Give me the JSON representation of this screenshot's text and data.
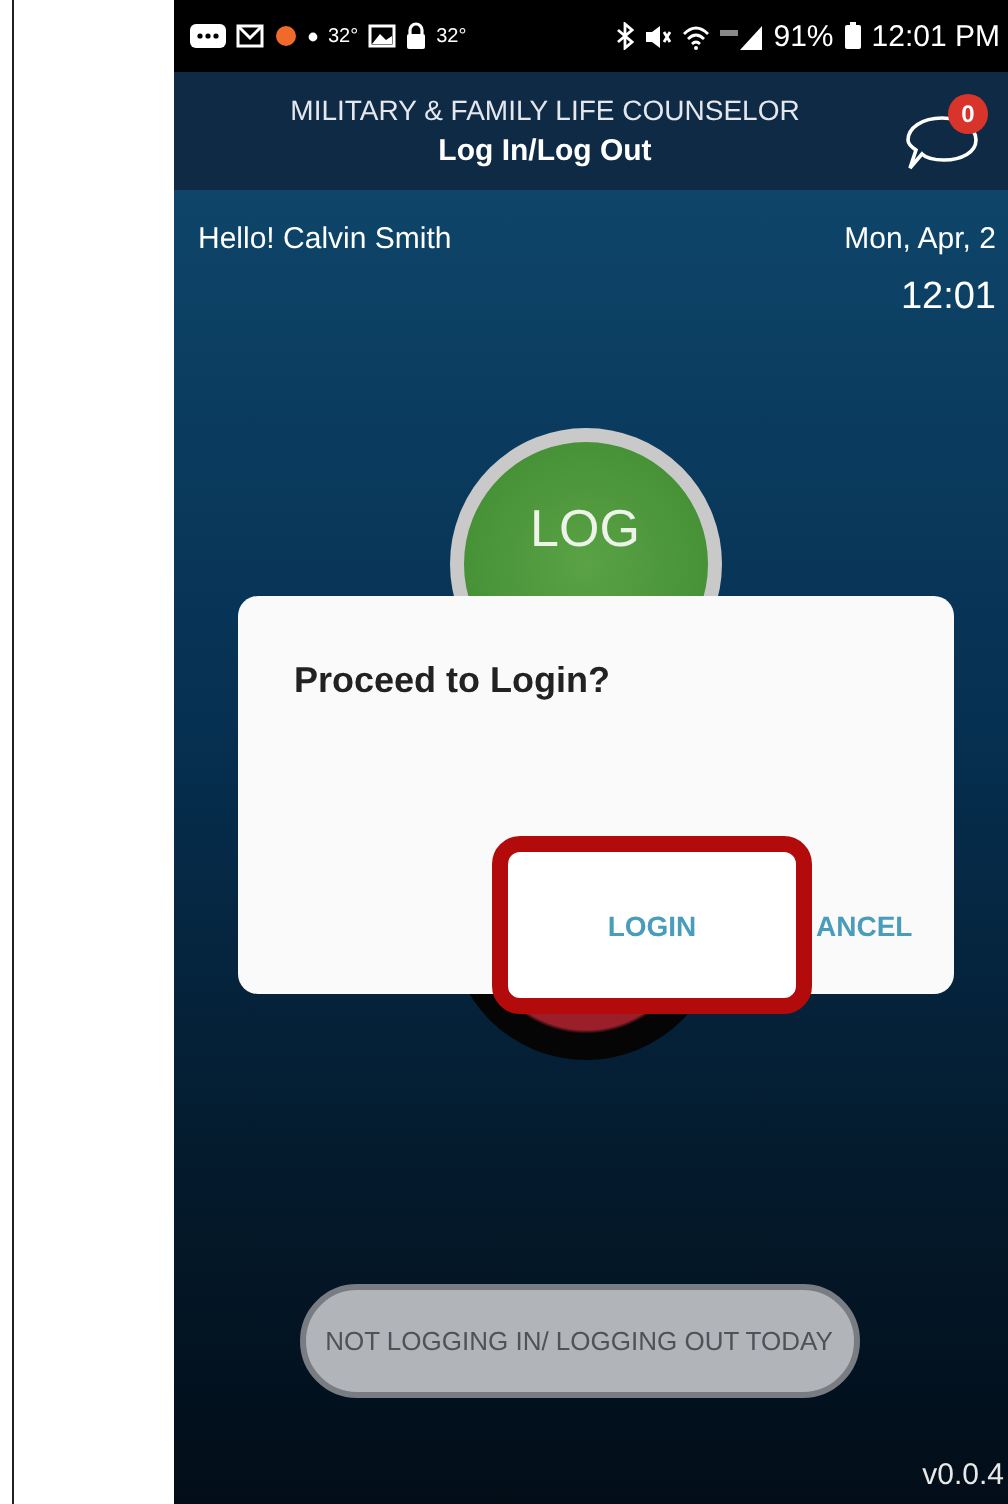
{
  "status_bar": {
    "left_items": [
      "32°",
      "32°"
    ],
    "battery": "91%",
    "time": "12:01 PM"
  },
  "header": {
    "title": "MILITARY & FAMILY LIFE COUNSELOR",
    "subtitle": "Log In/Log Out",
    "message_badge": {
      "count": "0",
      "color": "#d9342b"
    }
  },
  "greeting": "Hello! Calvin Smith",
  "date": "Mon, Apr, 2",
  "clock": "12:01",
  "log_button": {
    "label": "LOG"
  },
  "dialog": {
    "title": "Proceed to Login?",
    "buttons": [
      {
        "label": "LOGIN",
        "highlighted": true
      },
      {
        "label": "ANCEL",
        "highlighted": false
      }
    ]
  },
  "skip_button": "NOT LOGGING IN/ LOGGING OUT TODAY",
  "version": "v0.0.4"
}
